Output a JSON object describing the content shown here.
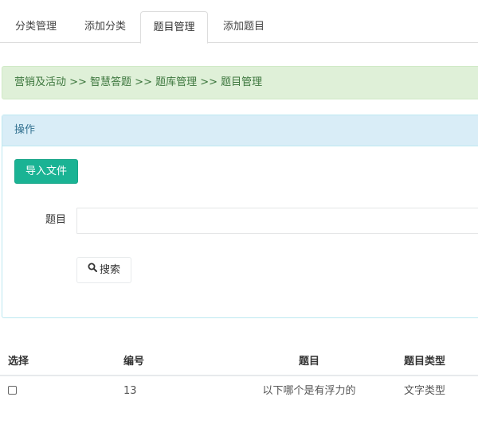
{
  "tabs": [
    {
      "label": "分类管理"
    },
    {
      "label": "添加分类"
    },
    {
      "label": "题目管理"
    },
    {
      "label": "添加题目"
    }
  ],
  "breadcrumb": "营销及活动 >> 智慧答题 >> 题库管理 >> 题目管理",
  "panel": {
    "title": "操作",
    "import_button": "导入文件",
    "question_label": "题目",
    "question_value": "",
    "search_button": "搜索"
  },
  "table": {
    "headers": [
      "选择",
      "编号",
      "题目",
      "题目类型"
    ],
    "rows": [
      {
        "id": "13",
        "question": "以下哪个是有浮力的",
        "type": "文字类型"
      }
    ]
  },
  "colors": {
    "accent": "#1ab394",
    "breadcrumb_bg": "#dff0d8",
    "breadcrumb_text": "#3c763d",
    "panel_heading_bg": "#d9edf7",
    "panel_heading_text": "#31708f"
  },
  "icons": {
    "search": "search-icon"
  }
}
